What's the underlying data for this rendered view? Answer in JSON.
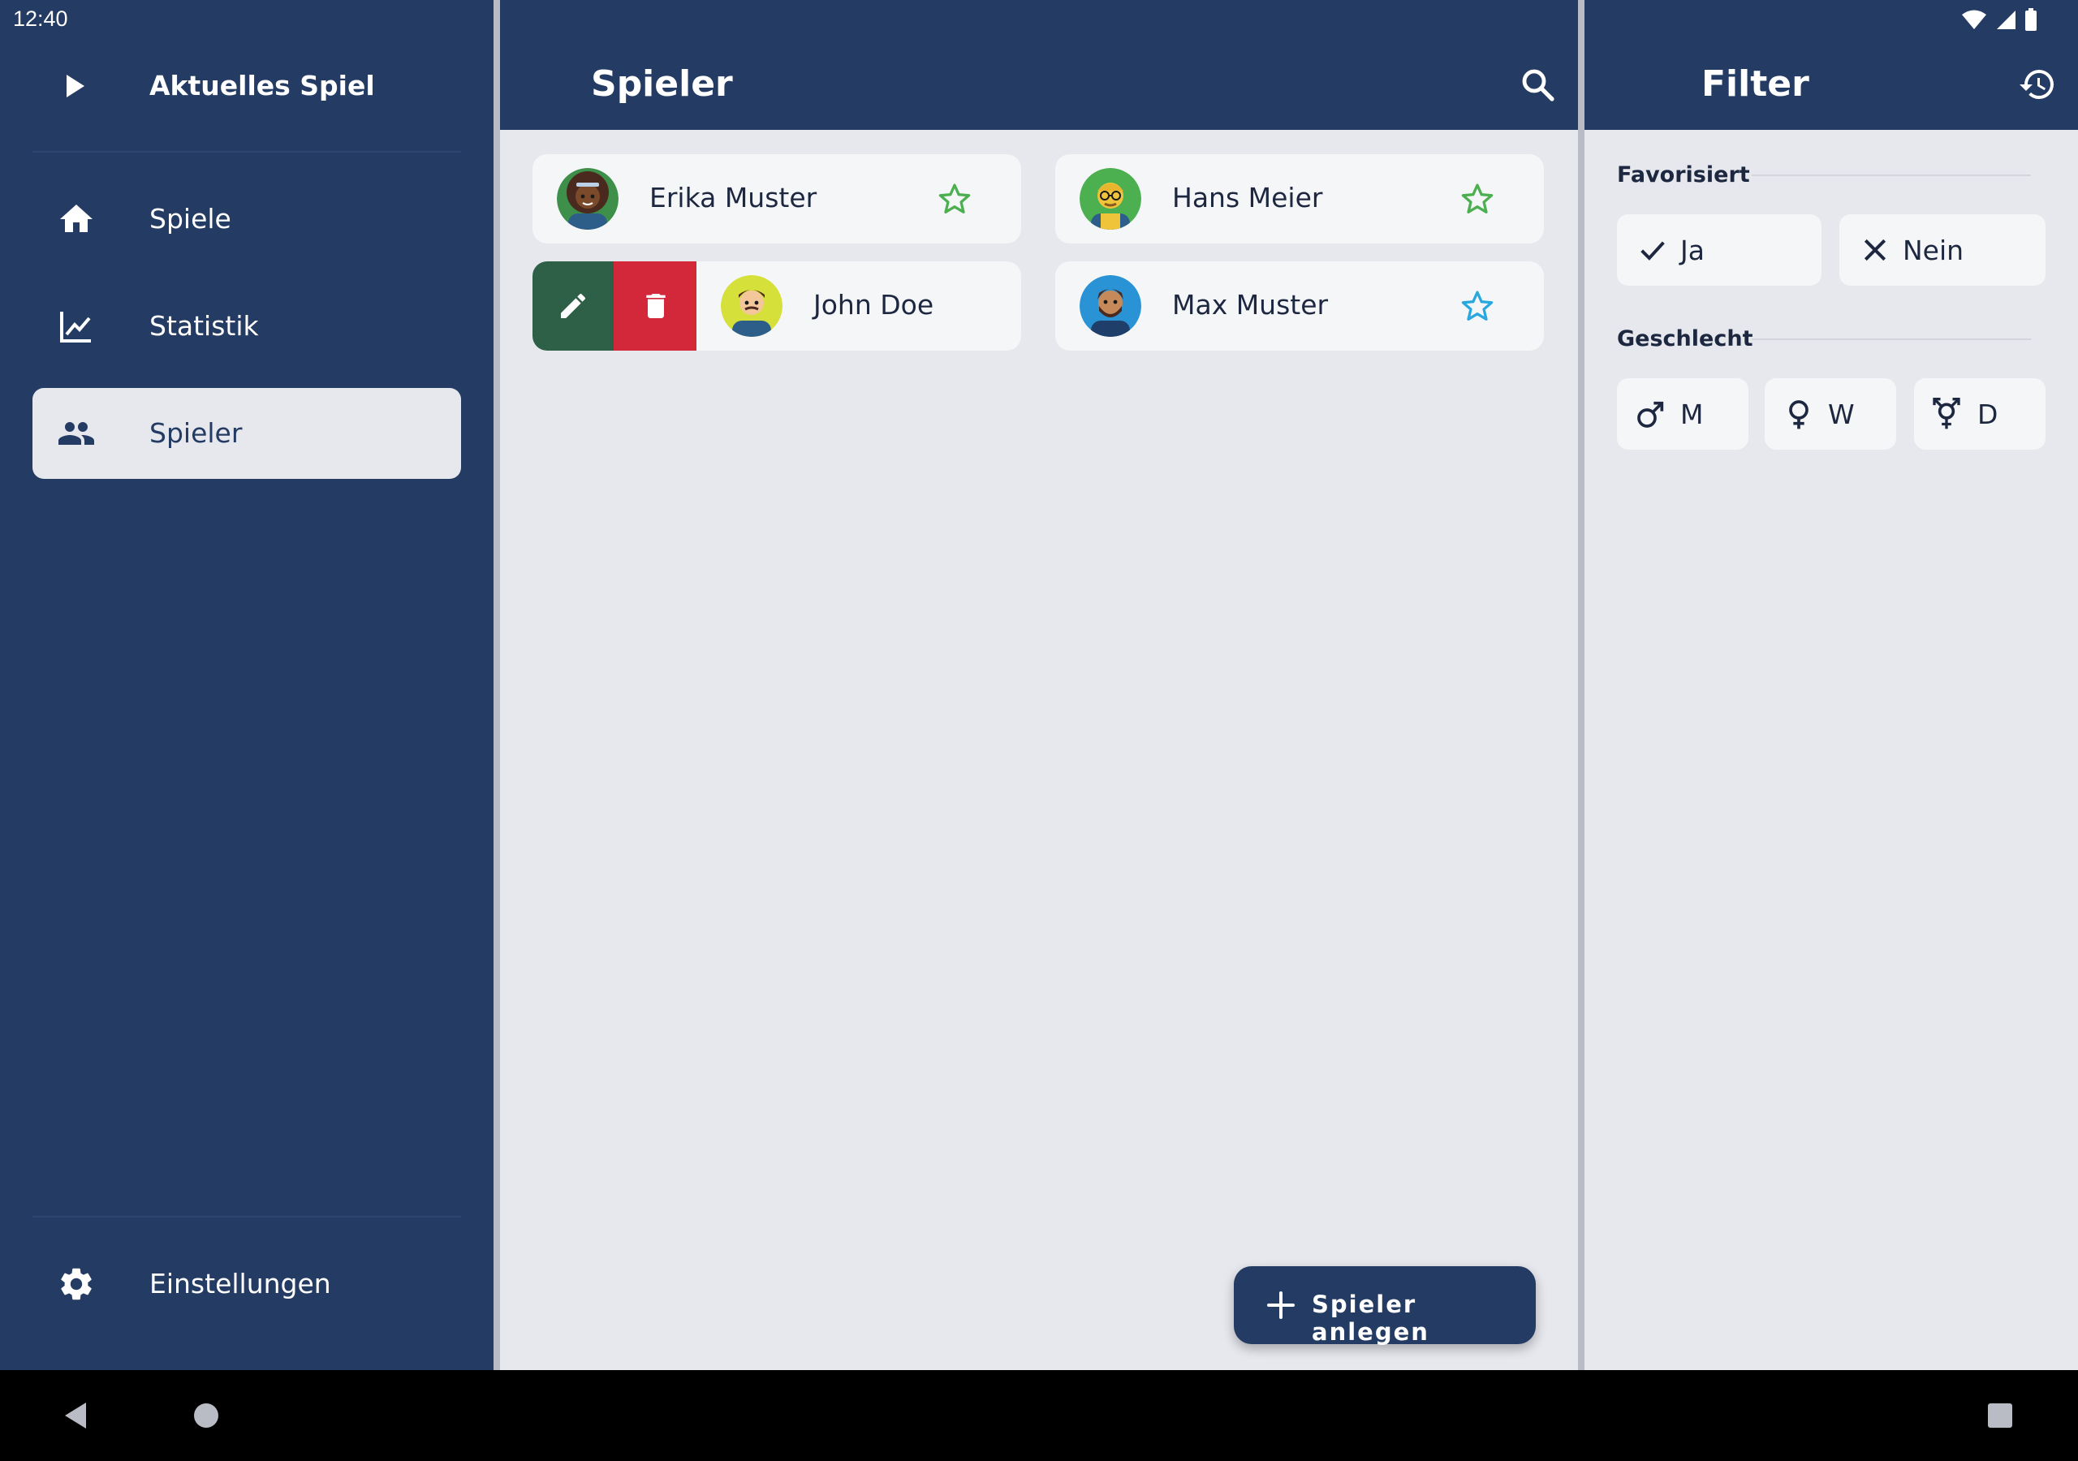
{
  "status_bar": {
    "time": "12:40"
  },
  "drawer": {
    "header": {
      "title": "Aktuelles Spiel",
      "icon": "play-icon"
    },
    "items": [
      {
        "label": "Spiele",
        "icon": "home-icon",
        "active": false
      },
      {
        "label": "Statistik",
        "icon": "chart-icon",
        "active": false
      },
      {
        "label": "Spieler",
        "icon": "people-icon",
        "active": true
      }
    ],
    "settings": {
      "label": "Einstellungen",
      "icon": "gear-icon"
    }
  },
  "main": {
    "title": "Spieler",
    "search_icon": "search-icon",
    "players": [
      {
        "name": "Erika Muster",
        "favorite": false
      },
      {
        "name": "Hans Meier",
        "favorite": false
      },
      {
        "name": "John Doe",
        "favorite": false,
        "swiped": true
      },
      {
        "name": "Max Muster",
        "favorite": false,
        "highlighted": true
      }
    ],
    "fab": {
      "label": "Spieler anlegen",
      "icon": "plus-icon"
    }
  },
  "filter": {
    "title": "Filter",
    "reset_icon": "history-icon",
    "favorite_section": {
      "label": "Favorisiert",
      "options": [
        {
          "label": "Ja",
          "icon": "check-icon"
        },
        {
          "label": "Nein",
          "icon": "close-icon"
        }
      ]
    },
    "gender_section": {
      "label": "Geschlecht",
      "options": [
        {
          "label": "M",
          "icon": "male-icon"
        },
        {
          "label": "W",
          "icon": "female-icon"
        },
        {
          "label": "D",
          "icon": "diverse-icon"
        }
      ]
    }
  },
  "colors": {
    "primary": "#243b63",
    "background": "#e6e8ee",
    "card": "#f5f6f8",
    "edit": "#2e6047",
    "delete": "#d3283a",
    "star_default": "#4caf50",
    "star_active": "#29a8e0"
  }
}
